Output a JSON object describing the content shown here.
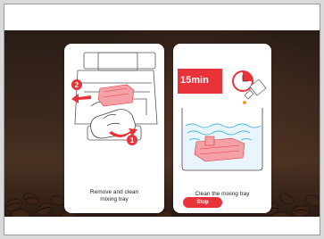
{
  "steps": [
    {
      "caption_line1": "Remove and clean",
      "caption_line2": "mixing tray",
      "markers": [
        "1",
        "2"
      ]
    },
    {
      "timer": "15min",
      "caption": "Clean the mixing tray",
      "stop_label": "Stop"
    }
  ],
  "colors": {
    "accent": "#e8333a",
    "tray_pink": "#f3a1a6",
    "water": "#4bb4e6"
  }
}
